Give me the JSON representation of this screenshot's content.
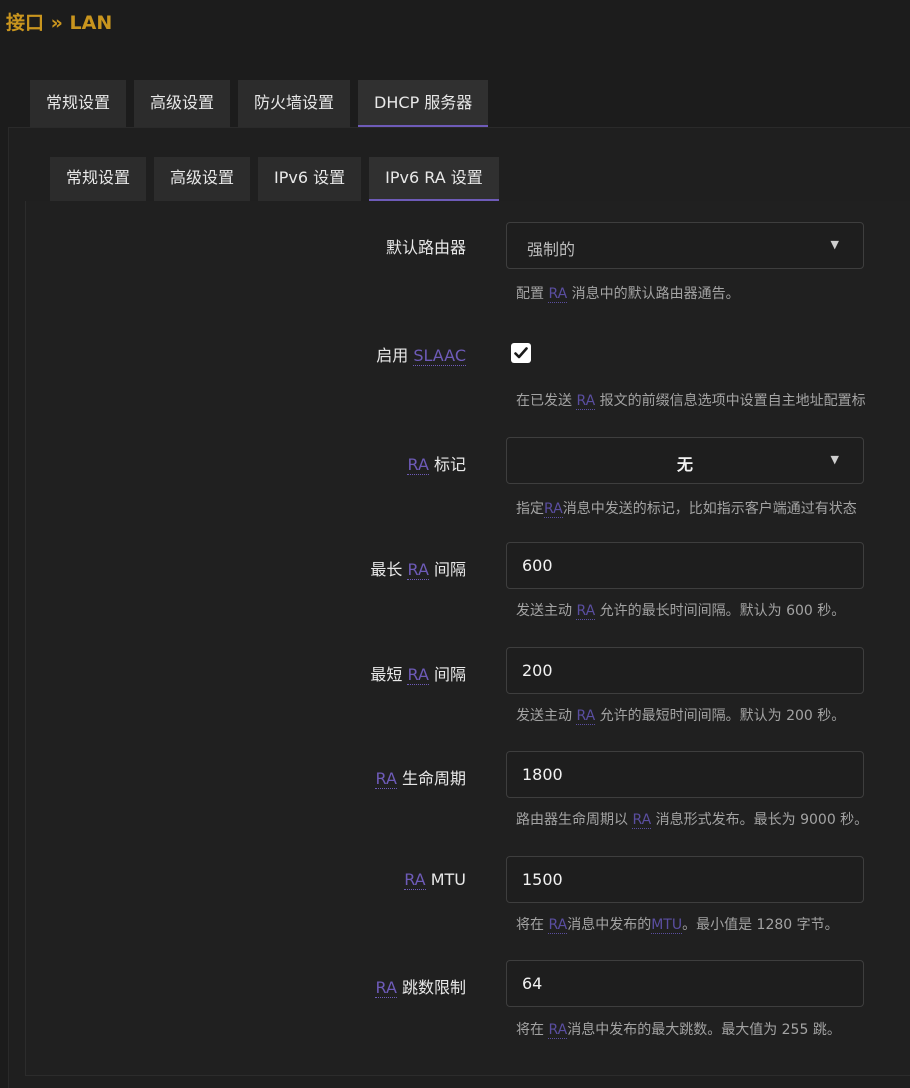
{
  "breadcrumb": "接口 » LAN",
  "top_tabs": [
    {
      "label": "常规设置"
    },
    {
      "label": "高级设置"
    },
    {
      "label": "防火墙设置"
    },
    {
      "label": "DHCP 服务器",
      "active": true
    }
  ],
  "sub_tabs": [
    {
      "label": "常规设置"
    },
    {
      "label": "高级设置"
    },
    {
      "label": "IPv6 设置"
    },
    {
      "label": "IPv6 RA 设置",
      "active": true
    }
  ],
  "fields": {
    "default_router": {
      "label": "默认路由器",
      "value": "强制的",
      "desc_pre": "配置 ",
      "desc_abbr": "RA",
      "desc_post": " 消息中的默认路由器通告。"
    },
    "slaac": {
      "label_pre": "启用 ",
      "label_abbr": "SLAAC",
      "checked": true,
      "desc_pre": "在已发送 ",
      "desc_abbr": "RA",
      "desc_post": " 报文的前缀信息选项中设置自主地址配置标"
    },
    "ra_flags": {
      "label_abbr": "RA",
      "label_post": " 标记",
      "value": "无",
      "desc_pre": "指定",
      "desc_abbr": "RA",
      "desc_post": "消息中发送的标记，比如指示客户端通过有状态"
    },
    "max_interval": {
      "label_pre": "最长 ",
      "label_abbr": "RA",
      "label_post": " 间隔",
      "value": "600",
      "desc_pre": "发送主动 ",
      "desc_abbr": "RA",
      "desc_post": " 允许的最长时间间隔。默认为 600 秒。"
    },
    "min_interval": {
      "label_pre": "最短 ",
      "label_abbr": "RA",
      "label_post": " 间隔",
      "value": "200",
      "desc_pre": "发送主动 ",
      "desc_abbr": "RA",
      "desc_post": " 允许的最短时间间隔。默认为 200 秒。"
    },
    "lifetime": {
      "label_abbr": "RA",
      "label_post": " 生命周期",
      "value": "1800",
      "desc_pre": "路由器生命周期以 ",
      "desc_abbr": "RA",
      "desc_post": " 消息形式发布。最长为 9000 秒。"
    },
    "mtu": {
      "label_abbr": "RA",
      "label_post": " MTU",
      "value": "1500",
      "desc_pre": "将在 ",
      "desc_abbr": "RA",
      "desc_mid": "消息中发布的",
      "desc_abbr2": "MTU",
      "desc_post": "。最小值是 1280 字节。"
    },
    "hop_limit": {
      "label_abbr": "RA",
      "label_post": " 跳数限制",
      "value": "64",
      "desc_pre": "将在 ",
      "desc_abbr": "RA",
      "desc_post": "消息中发布的最大跳数。最大值为 255 跳。"
    }
  },
  "colors": {
    "accent": "#6e5bb8",
    "breadcrumb": "#c9951e",
    "background": "#1c1c1c"
  }
}
